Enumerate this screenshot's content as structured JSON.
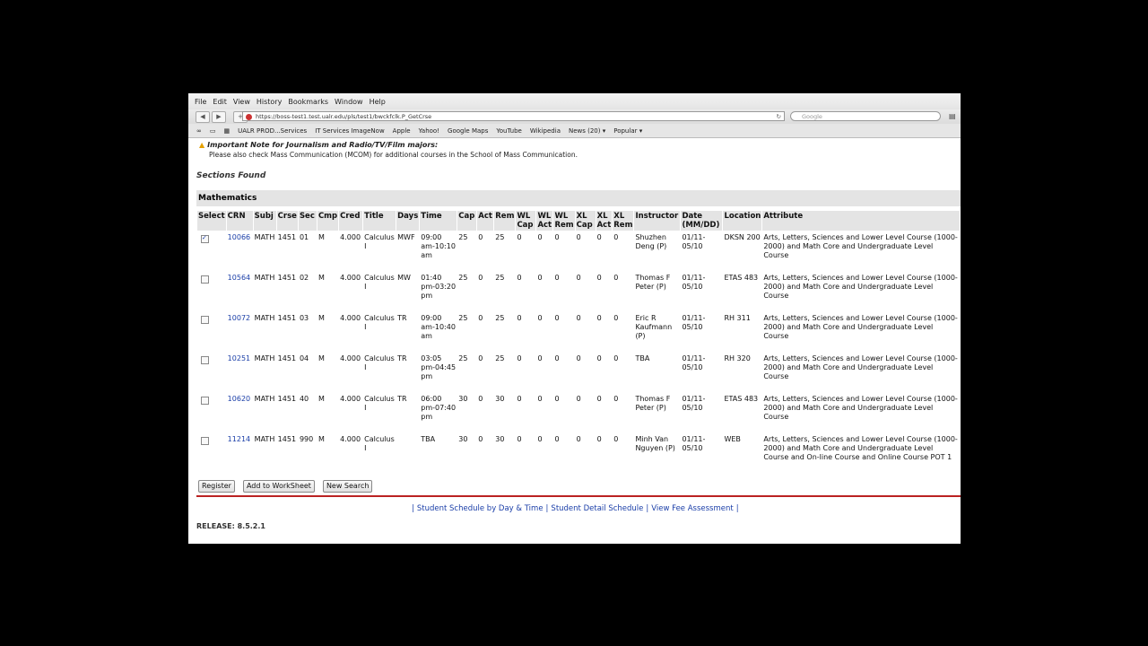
{
  "menu": [
    "File",
    "Edit",
    "View",
    "History",
    "Bookmarks",
    "Window",
    "Help"
  ],
  "nav": {
    "url": "https://boss-test1.test.ualr.edu/pls/test1/bwckfclk.P_GetCrse",
    "search_placeholder": "Google"
  },
  "bookmarks": [
    "UALR PROD...Services",
    "IT Services ImageNow",
    "Apple",
    "Yahoo!",
    "Google Maps",
    "YouTube",
    "Wikipedia",
    "News (20) ▾",
    "Popular ▾"
  ],
  "note": {
    "title": "Important Note for Journalism and Radio/TV/Film majors:",
    "text": "Please also check Mass Communication (MCOM) for additional courses in the School of Mass Communication."
  },
  "sections_found": "Sections Found",
  "subject": "Mathematics",
  "columns": [
    "Select",
    "CRN",
    "Subj",
    "Crse",
    "Sec",
    "Cmp",
    "Cred",
    "Title",
    "Days",
    "Time",
    "Cap",
    "Act",
    "Rem",
    "WL Cap",
    "WL Act",
    "WL Rem",
    "XL Cap",
    "XL Act",
    "XL Rem",
    "Instructor",
    "Date (MM/DD)",
    "Location",
    "Attribute"
  ],
  "rows": [
    {
      "checked": true,
      "crn": "10066",
      "subj": "MATH",
      "crse": "1451",
      "sec": "01",
      "cmp": "M",
      "cred": "4.000",
      "title": "Calculus I",
      "days": "MWF",
      "time": "09:00 am-10:10 am",
      "cap": "25",
      "act": "0",
      "rem": "25",
      "wlcap": "0",
      "wlact": "0",
      "wlrem": "0",
      "xlcap": "0",
      "xlact": "0",
      "xlrem": "0",
      "instructor": "Shuzhen Deng (P)",
      "date": "01/11-05/10",
      "location": "DKSN 200",
      "attribute": "Arts, Letters, Sciences and Lower Level Course (1000-2000) and Math Core and Undergraduate Level Course"
    },
    {
      "checked": false,
      "crn": "10564",
      "subj": "MATH",
      "crse": "1451",
      "sec": "02",
      "cmp": "M",
      "cred": "4.000",
      "title": "Calculus I",
      "days": "MW",
      "time": "01:40 pm-03:20 pm",
      "cap": "25",
      "act": "0",
      "rem": "25",
      "wlcap": "0",
      "wlact": "0",
      "wlrem": "0",
      "xlcap": "0",
      "xlact": "0",
      "xlrem": "0",
      "instructor": "Thomas F Peter (P)",
      "date": "01/11-05/10",
      "location": "ETAS 483",
      "attribute": "Arts, Letters, Sciences and Lower Level Course (1000-2000) and Math Core and Undergraduate Level Course"
    },
    {
      "checked": false,
      "crn": "10072",
      "subj": "MATH",
      "crse": "1451",
      "sec": "03",
      "cmp": "M",
      "cred": "4.000",
      "title": "Calculus I",
      "days": "TR",
      "time": "09:00 am-10:40 am",
      "cap": "25",
      "act": "0",
      "rem": "25",
      "wlcap": "0",
      "wlact": "0",
      "wlrem": "0",
      "xlcap": "0",
      "xlact": "0",
      "xlrem": "0",
      "instructor": "Eric R Kaufmann (P)",
      "date": "01/11-05/10",
      "location": "RH 311",
      "attribute": "Arts, Letters, Sciences and Lower Level Course (1000-2000) and Math Core and Undergraduate Level Course"
    },
    {
      "checked": false,
      "crn": "10251",
      "subj": "MATH",
      "crse": "1451",
      "sec": "04",
      "cmp": "M",
      "cred": "4.000",
      "title": "Calculus I",
      "days": "TR",
      "time": "03:05 pm-04:45 pm",
      "cap": "25",
      "act": "0",
      "rem": "25",
      "wlcap": "0",
      "wlact": "0",
      "wlrem": "0",
      "xlcap": "0",
      "xlact": "0",
      "xlrem": "0",
      "instructor": "TBA",
      "date": "01/11-05/10",
      "location": "RH 320",
      "attribute": "Arts, Letters, Sciences and Lower Level Course (1000-2000) and Math Core and Undergraduate Level Course"
    },
    {
      "checked": false,
      "crn": "10620",
      "subj": "MATH",
      "crse": "1451",
      "sec": "40",
      "cmp": "M",
      "cred": "4.000",
      "title": "Calculus I",
      "days": "TR",
      "time": "06:00 pm-07:40 pm",
      "cap": "30",
      "act": "0",
      "rem": "30",
      "wlcap": "0",
      "wlact": "0",
      "wlrem": "0",
      "xlcap": "0",
      "xlact": "0",
      "xlrem": "0",
      "instructor": "Thomas F Peter (P)",
      "date": "01/11-05/10",
      "location": "ETAS 483",
      "attribute": "Arts, Letters, Sciences and Lower Level Course (1000-2000) and Math Core and Undergraduate Level Course"
    },
    {
      "checked": false,
      "crn": "11214",
      "subj": "MATH",
      "crse": "1451",
      "sec": "990",
      "cmp": "M",
      "cred": "4.000",
      "title": "Calculus I",
      "days": "",
      "time": "TBA",
      "cap": "30",
      "act": "0",
      "rem": "30",
      "wlcap": "0",
      "wlact": "0",
      "wlrem": "0",
      "xlcap": "0",
      "xlact": "0",
      "xlrem": "0",
      "instructor": "Minh Van Nguyen (P)",
      "date": "01/11-05/10",
      "location": "WEB",
      "attribute": "Arts, Letters, Sciences and Lower Level Course (1000-2000) and Math Core and Undergraduate Level Course and On-line Course and Online Course POT 1"
    }
  ],
  "buttons": {
    "register": "Register",
    "worksheet": "Add to WorkSheet",
    "new_search": "New Search"
  },
  "links": [
    "Student Schedule by Day & Time",
    "Student Detail Schedule",
    "View Fee Assessment"
  ],
  "release": "RELEASE: 8.5.2.1"
}
